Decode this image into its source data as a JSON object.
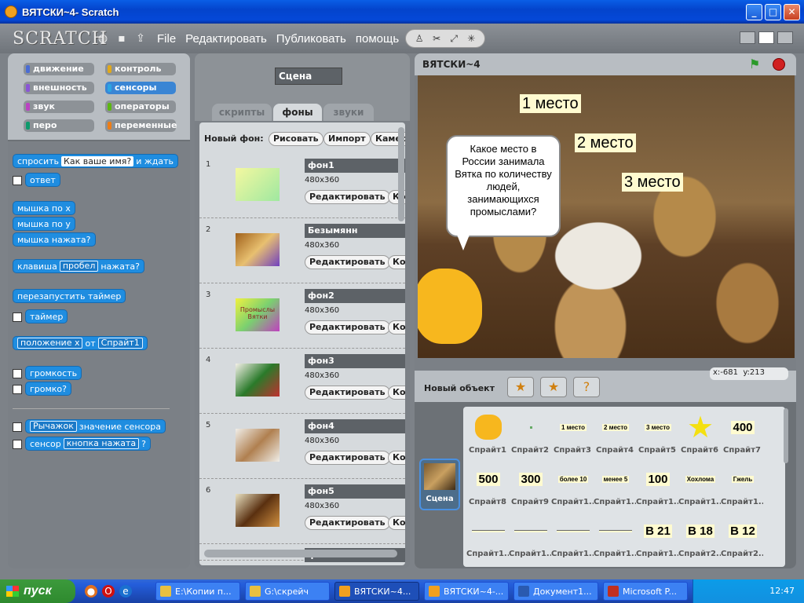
{
  "window": {
    "title": "ВЯТСКИ~4- Scratch",
    "min": "_",
    "max": "□",
    "close": "✕"
  },
  "menu": {
    "logo": "SCRATCH",
    "items": [
      "File",
      "Редактировать",
      "Публиковать",
      "помощь"
    ]
  },
  "categories": [
    {
      "label": "движение",
      "color": "#4a6cd4"
    },
    {
      "label": "контроль",
      "color": "#e1a91a"
    },
    {
      "label": "внешность",
      "color": "#8a55d7"
    },
    {
      "label": "сенсоры",
      "color": "#2ca5e2"
    },
    {
      "label": "звук",
      "color": "#bb42c3"
    },
    {
      "label": "операторы",
      "color": "#5cb712"
    },
    {
      "label": "перо",
      "color": "#0e9a6c"
    },
    {
      "label": "переменные",
      "color": "#ee7d16"
    }
  ],
  "blocks": {
    "ask_a": "спросить",
    "ask_val": "Как ваше имя?",
    "ask_b": "и ждать",
    "answer": "ответ",
    "mousex": "мышка по x",
    "mousey": "мышка по y",
    "mousedown": "мышка нажата?",
    "key_a": "клавиша",
    "key_val": "пробел",
    "key_b": "нажата?",
    "reset": "перезапустить таймер",
    "timer": "таймер",
    "pos_val": "положение x",
    "pos_of": "от",
    "pos_spr": "Спрайт1",
    "loudness": "громкость",
    "loud": "громко?",
    "sensor_val": "Рычажок",
    "sensor_lbl": "значение сенсора",
    "sensor2": "сенсор",
    "sensor2_val": "кнопка нажата",
    "sensor2_q": "?"
  },
  "scene": {
    "name": "Сцена",
    "tabs": [
      "скрипты",
      "фоны",
      "звуки"
    ]
  },
  "costumes": {
    "new_label": "Новый фон:",
    "btn_paint": "Рисовать",
    "btn_import": "Импорт",
    "btn_camera": "Камера",
    "edit": "Редактировать",
    "copy": "Копи",
    "items": [
      {
        "num": "1",
        "name": "фон1",
        "size": "480x360",
        "thumb": "linear-gradient(135deg,#f4f8a0,#9fe8a0)"
      },
      {
        "num": "2",
        "name": "Безымянн",
        "size": "480x360",
        "thumb": "linear-gradient(135deg,#a0601a,#e8c070,#7040c0)"
      },
      {
        "num": "3",
        "name": "фон2",
        "size": "480x360",
        "thumb": "linear-gradient(135deg,#f0f040,#7ad070,#c040c0)",
        "thumb_text": "Промыслы Вятки"
      },
      {
        "num": "4",
        "name": "фон3",
        "size": "480x360",
        "thumb": "linear-gradient(135deg,#f4f0e8,#2a7a2a,#c03030)"
      },
      {
        "num": "5",
        "name": "фон4",
        "size": "480x360",
        "thumb": "linear-gradient(135deg,#f0eee8,#b08050,#f0eee8)"
      },
      {
        "num": "6",
        "name": "фон5",
        "size": "480x360",
        "thumb": "linear-gradient(135deg,#e8e0c0,#5a3010,#d09040)"
      }
    ],
    "partial": "фон6"
  },
  "stage": {
    "title": "ВЯТСКИ~4",
    "labels": [
      "1 место",
      "2 место",
      "3 место"
    ],
    "bubble": "Какое место в России занимала Вятка по количеству людей, занимающихся промыслами?",
    "x_label": "x:",
    "x_val": "-681",
    "y_label": "y:",
    "y_val": "213"
  },
  "new_object": "Новый объект",
  "scene_tile": "Сцена",
  "sprites": [
    {
      "name": "Спрайт1",
      "thumb": "cat"
    },
    {
      "name": "Спрайт2",
      "thumb": "dot"
    },
    {
      "name": "Спрайт3",
      "thumb": "1 место"
    },
    {
      "name": "Спрайт4",
      "thumb": "2 место"
    },
    {
      "name": "Спрайт5",
      "thumb": "3 место"
    },
    {
      "name": "Спрайт6",
      "thumb": "star"
    },
    {
      "name": "Спрайт7",
      "thumb": "400"
    },
    {
      "name": "Спрайт8",
      "thumb": "500"
    },
    {
      "name": "Спрайт9",
      "thumb": "300"
    },
    {
      "name": "Спрайт1...",
      "thumb": "более 10"
    },
    {
      "name": "Спрайт1...",
      "thumb": "менее 5"
    },
    {
      "name": "Спрайт1...",
      "thumb": "100"
    },
    {
      "name": "Спрайт1...",
      "thumb": "Хохлома"
    },
    {
      "name": "Спрайт1...",
      "thumb": "Гжель"
    },
    {
      "name": "Спрайт1...",
      "thumb": "line"
    },
    {
      "name": "Спрайт1...",
      "thumb": "line"
    },
    {
      "name": "Спрайт1...",
      "thumb": "line"
    },
    {
      "name": "Спрайт1...",
      "thumb": "line"
    },
    {
      "name": "Спрайт1...",
      "thumb": "В 21"
    },
    {
      "name": "Спрайт2...",
      "thumb": "В 18"
    },
    {
      "name": "Спрайт2...",
      "thumb": "В 12"
    }
  ],
  "taskbar": {
    "start": "пуск",
    "tasks": [
      "E:\\Копии п...",
      "G:\\скрейч",
      "ВЯТСКИ~4...",
      "ВЯТСКИ~4-...",
      "Документ1...",
      "Microsoft P..."
    ],
    "lang": "RL",
    "clock": "12:47"
  }
}
